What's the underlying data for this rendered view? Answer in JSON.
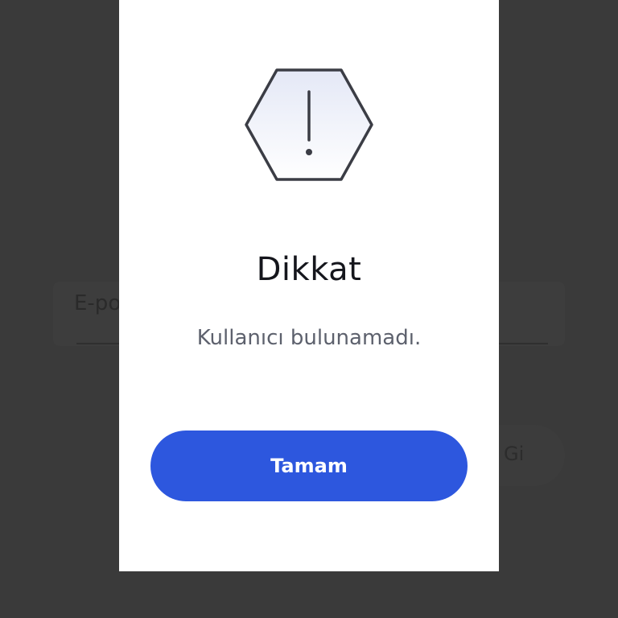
{
  "background": {
    "email_placeholder": "E-po",
    "button_label": "Gi"
  },
  "modal": {
    "icon": "warning-hexagon-icon",
    "title": "Dikkat",
    "message": "Kullanıcı bulunamadı.",
    "ok_label": "Tamam"
  },
  "colors": {
    "overlay": "#3a3a3a",
    "modal_bg": "#ffffff",
    "primary_button": "#2d57de",
    "title_text": "#15161c",
    "message_text": "#5d616d"
  }
}
